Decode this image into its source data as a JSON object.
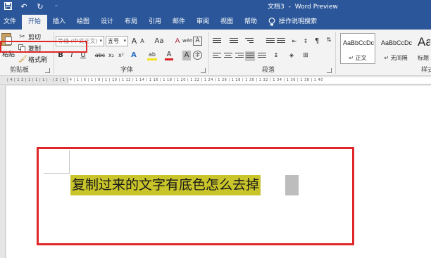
{
  "titlebar": {
    "doc_name": "文档3",
    "separator": "-",
    "app_name": "Word Preview"
  },
  "qat": {
    "save_icon": "save-icon",
    "undo_icon": "undo-icon",
    "redo_icon": "redo-icon",
    "customize_icon": "customize-qat-icon"
  },
  "tabs": [
    "文件",
    "开始",
    "插入",
    "绘图",
    "设计",
    "布局",
    "引用",
    "邮件",
    "审阅",
    "视图",
    "帮助"
  ],
  "tell_me": "操作说明搜索",
  "clipboard": {
    "paste": "粘贴",
    "cut": "剪切",
    "copy": "复制",
    "format_painter": "格式刷",
    "group_label": "剪贴板"
  },
  "font": {
    "font_name": "等线 (中文正文)",
    "font_size": "五号",
    "grow": "A",
    "shrink": "A",
    "change_case": "Aa",
    "clear_format": "A",
    "phonetic": "wén",
    "char_border": "A",
    "bold": "B",
    "italic": "I",
    "underline": "U",
    "strike": "abc",
    "subscript": "x₂",
    "superscript": "x²",
    "text_effect": "A",
    "highlight": "ab",
    "font_color": "A",
    "char_shading": "A",
    "enclose": "字",
    "group_label": "字体"
  },
  "paragraph": {
    "group_label": "段落"
  },
  "styles": {
    "items": [
      {
        "sample": "AaBbCcDc",
        "name": "↵ 正文"
      },
      {
        "sample": "AaBbCcDc",
        "name": "↵ 无间隔"
      },
      {
        "sample": "Aa",
        "name": "标题"
      }
    ],
    "group_label": "样式"
  },
  "document": {
    "text": "复制过来的文字有底色怎么去掉"
  },
  "colors": {
    "accent": "#2b579a",
    "annotation": "#e02626",
    "text_highlight": "#c8c42a"
  }
}
